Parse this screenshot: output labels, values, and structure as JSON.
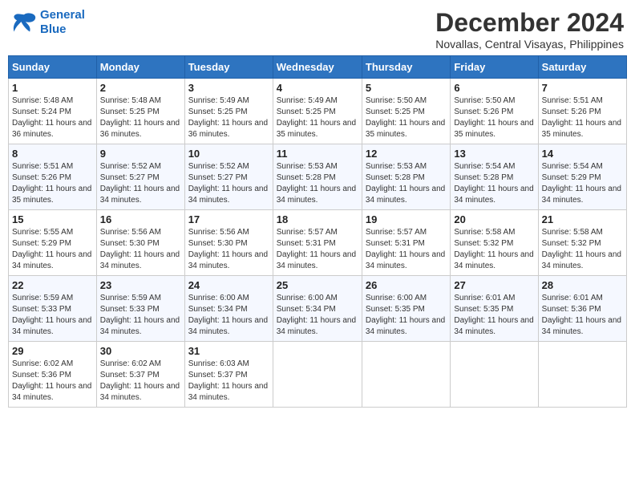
{
  "logo": {
    "line1": "General",
    "line2": "Blue"
  },
  "title": "December 2024",
  "location": "Novallas, Central Visayas, Philippines",
  "days_of_week": [
    "Sunday",
    "Monday",
    "Tuesday",
    "Wednesday",
    "Thursday",
    "Friday",
    "Saturday"
  ],
  "weeks": [
    [
      {
        "day": "1",
        "sunrise": "Sunrise: 5:48 AM",
        "sunset": "Sunset: 5:24 PM",
        "daylight": "Daylight: 11 hours and 36 minutes."
      },
      {
        "day": "2",
        "sunrise": "Sunrise: 5:48 AM",
        "sunset": "Sunset: 5:25 PM",
        "daylight": "Daylight: 11 hours and 36 minutes."
      },
      {
        "day": "3",
        "sunrise": "Sunrise: 5:49 AM",
        "sunset": "Sunset: 5:25 PM",
        "daylight": "Daylight: 11 hours and 36 minutes."
      },
      {
        "day": "4",
        "sunrise": "Sunrise: 5:49 AM",
        "sunset": "Sunset: 5:25 PM",
        "daylight": "Daylight: 11 hours and 35 minutes."
      },
      {
        "day": "5",
        "sunrise": "Sunrise: 5:50 AM",
        "sunset": "Sunset: 5:25 PM",
        "daylight": "Daylight: 11 hours and 35 minutes."
      },
      {
        "day": "6",
        "sunrise": "Sunrise: 5:50 AM",
        "sunset": "Sunset: 5:26 PM",
        "daylight": "Daylight: 11 hours and 35 minutes."
      },
      {
        "day": "7",
        "sunrise": "Sunrise: 5:51 AM",
        "sunset": "Sunset: 5:26 PM",
        "daylight": "Daylight: 11 hours and 35 minutes."
      }
    ],
    [
      {
        "day": "8",
        "sunrise": "Sunrise: 5:51 AM",
        "sunset": "Sunset: 5:26 PM",
        "daylight": "Daylight: 11 hours and 35 minutes."
      },
      {
        "day": "9",
        "sunrise": "Sunrise: 5:52 AM",
        "sunset": "Sunset: 5:27 PM",
        "daylight": "Daylight: 11 hours and 34 minutes."
      },
      {
        "day": "10",
        "sunrise": "Sunrise: 5:52 AM",
        "sunset": "Sunset: 5:27 PM",
        "daylight": "Daylight: 11 hours and 34 minutes."
      },
      {
        "day": "11",
        "sunrise": "Sunrise: 5:53 AM",
        "sunset": "Sunset: 5:28 PM",
        "daylight": "Daylight: 11 hours and 34 minutes."
      },
      {
        "day": "12",
        "sunrise": "Sunrise: 5:53 AM",
        "sunset": "Sunset: 5:28 PM",
        "daylight": "Daylight: 11 hours and 34 minutes."
      },
      {
        "day": "13",
        "sunrise": "Sunrise: 5:54 AM",
        "sunset": "Sunset: 5:28 PM",
        "daylight": "Daylight: 11 hours and 34 minutes."
      },
      {
        "day": "14",
        "sunrise": "Sunrise: 5:54 AM",
        "sunset": "Sunset: 5:29 PM",
        "daylight": "Daylight: 11 hours and 34 minutes."
      }
    ],
    [
      {
        "day": "15",
        "sunrise": "Sunrise: 5:55 AM",
        "sunset": "Sunset: 5:29 PM",
        "daylight": "Daylight: 11 hours and 34 minutes."
      },
      {
        "day": "16",
        "sunrise": "Sunrise: 5:56 AM",
        "sunset": "Sunset: 5:30 PM",
        "daylight": "Daylight: 11 hours and 34 minutes."
      },
      {
        "day": "17",
        "sunrise": "Sunrise: 5:56 AM",
        "sunset": "Sunset: 5:30 PM",
        "daylight": "Daylight: 11 hours and 34 minutes."
      },
      {
        "day": "18",
        "sunrise": "Sunrise: 5:57 AM",
        "sunset": "Sunset: 5:31 PM",
        "daylight": "Daylight: 11 hours and 34 minutes."
      },
      {
        "day": "19",
        "sunrise": "Sunrise: 5:57 AM",
        "sunset": "Sunset: 5:31 PM",
        "daylight": "Daylight: 11 hours and 34 minutes."
      },
      {
        "day": "20",
        "sunrise": "Sunrise: 5:58 AM",
        "sunset": "Sunset: 5:32 PM",
        "daylight": "Daylight: 11 hours and 34 minutes."
      },
      {
        "day": "21",
        "sunrise": "Sunrise: 5:58 AM",
        "sunset": "Sunset: 5:32 PM",
        "daylight": "Daylight: 11 hours and 34 minutes."
      }
    ],
    [
      {
        "day": "22",
        "sunrise": "Sunrise: 5:59 AM",
        "sunset": "Sunset: 5:33 PM",
        "daylight": "Daylight: 11 hours and 34 minutes."
      },
      {
        "day": "23",
        "sunrise": "Sunrise: 5:59 AM",
        "sunset": "Sunset: 5:33 PM",
        "daylight": "Daylight: 11 hours and 34 minutes."
      },
      {
        "day": "24",
        "sunrise": "Sunrise: 6:00 AM",
        "sunset": "Sunset: 5:34 PM",
        "daylight": "Daylight: 11 hours and 34 minutes."
      },
      {
        "day": "25",
        "sunrise": "Sunrise: 6:00 AM",
        "sunset": "Sunset: 5:34 PM",
        "daylight": "Daylight: 11 hours and 34 minutes."
      },
      {
        "day": "26",
        "sunrise": "Sunrise: 6:00 AM",
        "sunset": "Sunset: 5:35 PM",
        "daylight": "Daylight: 11 hours and 34 minutes."
      },
      {
        "day": "27",
        "sunrise": "Sunrise: 6:01 AM",
        "sunset": "Sunset: 5:35 PM",
        "daylight": "Daylight: 11 hours and 34 minutes."
      },
      {
        "day": "28",
        "sunrise": "Sunrise: 6:01 AM",
        "sunset": "Sunset: 5:36 PM",
        "daylight": "Daylight: 11 hours and 34 minutes."
      }
    ],
    [
      {
        "day": "29",
        "sunrise": "Sunrise: 6:02 AM",
        "sunset": "Sunset: 5:36 PM",
        "daylight": "Daylight: 11 hours and 34 minutes."
      },
      {
        "day": "30",
        "sunrise": "Sunrise: 6:02 AM",
        "sunset": "Sunset: 5:37 PM",
        "daylight": "Daylight: 11 hours and 34 minutes."
      },
      {
        "day": "31",
        "sunrise": "Sunrise: 6:03 AM",
        "sunset": "Sunset: 5:37 PM",
        "daylight": "Daylight: 11 hours and 34 minutes."
      },
      null,
      null,
      null,
      null
    ]
  ]
}
